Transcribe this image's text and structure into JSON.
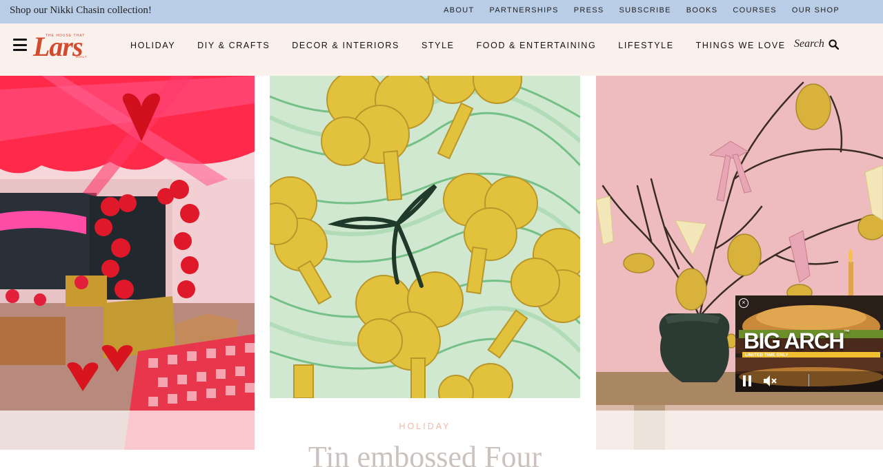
{
  "topbar": {
    "promo": "Shop our Nikki Chasin collection!",
    "links": [
      "ABOUT",
      "PARTNERSHIPS",
      "PRESS",
      "SUBSCRIBE",
      "BOOKS",
      "COURSES",
      "OUR SHOP"
    ]
  },
  "header": {
    "logo": {
      "tagline_top": "THE HOUSE THAT",
      "wordmark": "Lars",
      "tagline_bottom": "BUILT"
    },
    "nav": [
      "HOLIDAY",
      "DIY & CRAFTS",
      "DECOR & INTERIORS",
      "STYLE",
      "FOOD & ENTERTAINING",
      "LIFESTYLE",
      "THINGS WE LOVE"
    ],
    "search_label": "Search"
  },
  "feature": {
    "category": "HOLIDAY",
    "headline": "Tin embossed Four"
  },
  "ad": {
    "brand": "BIG ARCH",
    "tm": "™",
    "subtext": "LIMITED TIME ONLY",
    "close_glyph": "×"
  },
  "colors": {
    "topbar": "#b9cde6",
    "header_bg": "#fbf1ec",
    "logo": "#d24b2e",
    "category": "#f1b9a6"
  }
}
